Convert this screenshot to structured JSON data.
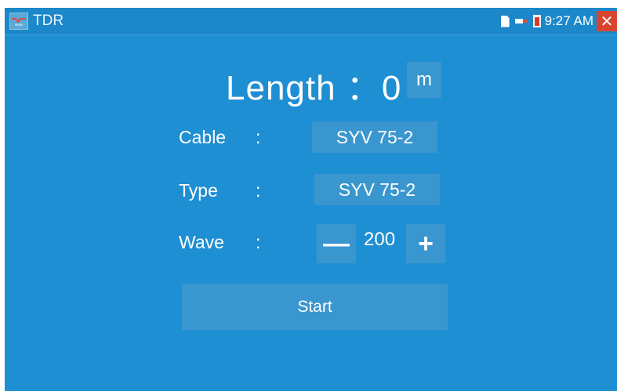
{
  "statusbar": {
    "app_title": "TDR",
    "time": "9:27 AM",
    "icons": [
      "tdr-app-icon",
      "sd-card-icon",
      "usb-icon",
      "battery-icon",
      "close-icon"
    ],
    "close_glyph": "✕"
  },
  "length": {
    "label": "Length ：",
    "value": "0",
    "unit": "m"
  },
  "cable": {
    "label": "Cable",
    "colon": ":",
    "value": "SYV 75-2"
  },
  "type": {
    "label": "Type",
    "colon": ":",
    "value": "SYV 75-2"
  },
  "wave": {
    "label": "Wave",
    "colon": ":",
    "minus": "—",
    "value": "200",
    "plus": "+"
  },
  "start_label": "Start",
  "colors": {
    "background": "#1f8fd3",
    "button": "#3a96cf",
    "close": "#d9442f"
  }
}
